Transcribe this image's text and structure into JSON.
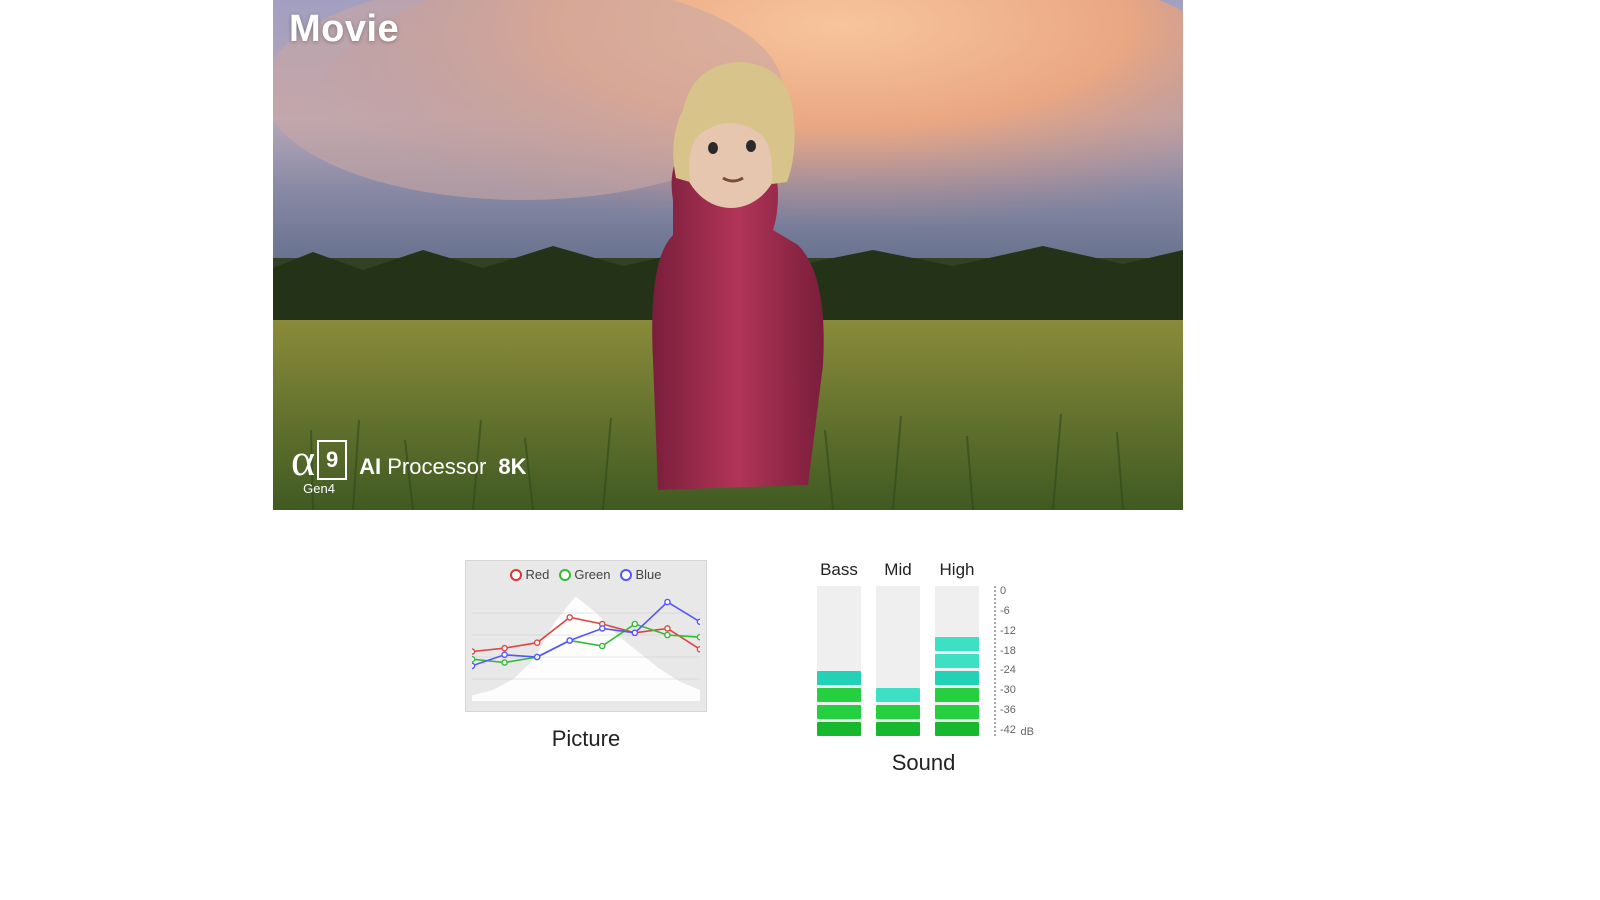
{
  "hero": {
    "mode_label": "Movie",
    "processor": {
      "alpha": "α",
      "nine": "9",
      "gen": "Gen4",
      "ai": "AI",
      "proc": "Processor",
      "eightk": "8K"
    }
  },
  "picture_panel": {
    "title": "Picture",
    "legend": {
      "red": "Red",
      "green": "Green",
      "blue": "Blue"
    },
    "chart_data": {
      "type": "line",
      "x": [
        0,
        1,
        2,
        3,
        4,
        5,
        6,
        7
      ],
      "series": [
        {
          "name": "Red",
          "color": "#d44",
          "values": [
            45,
            48,
            53,
            76,
            70,
            62,
            66,
            47
          ]
        },
        {
          "name": "Green",
          "color": "#3b3",
          "values": [
            38,
            35,
            40,
            55,
            50,
            70,
            60,
            58
          ]
        },
        {
          "name": "Blue",
          "color": "#55f",
          "values": [
            32,
            42,
            40,
            55,
            66,
            62,
            90,
            72
          ]
        }
      ],
      "ylim": [
        0,
        100
      ],
      "histogram": [
        5,
        10,
        20,
        38,
        72,
        95,
        80,
        60,
        45,
        30,
        18,
        10
      ]
    }
  },
  "sound_panel": {
    "title": "Sound",
    "headers": {
      "bass": "Bass",
      "mid": "Mid",
      "high": "High"
    },
    "db_unit": "dB",
    "chart_data": {
      "type": "bar",
      "ticks": [
        0,
        -6,
        -12,
        -18,
        -24,
        -30,
        -36,
        -42
      ],
      "columns": [
        {
          "name": "Bass",
          "segments": [
            "gd",
            "grn",
            "grn",
            "teal"
          ]
        },
        {
          "name": "Mid",
          "segments": [
            "gd",
            "grn",
            "tlite"
          ]
        },
        {
          "name": "High",
          "segments": [
            "gd",
            "grn",
            "grn",
            "teal",
            "tlite",
            "tlite"
          ]
        }
      ]
    }
  }
}
